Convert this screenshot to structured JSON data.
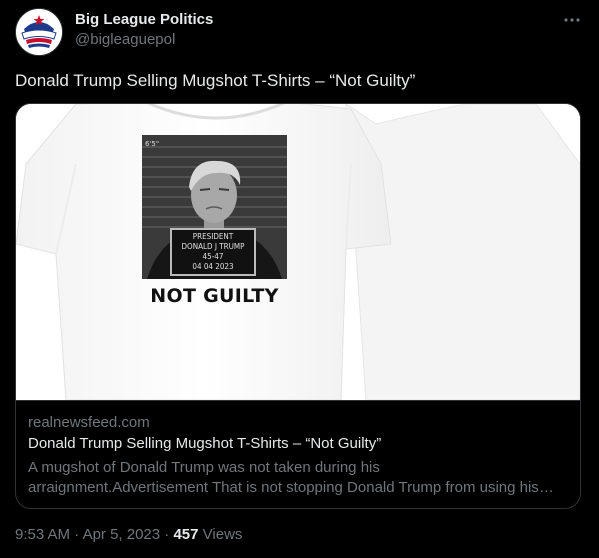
{
  "author": {
    "name": "Big League Politics",
    "handle": "@bigleaguepol",
    "avatar_text": "Big League Politics"
  },
  "tweet": {
    "text": "Donald Trump Selling Mugshot T-Shirts – “Not Guilty”"
  },
  "card": {
    "domain": "realnewsfeed.com",
    "title": "Donald Trump Selling Mugshot T-Shirts – “Not Guilty”",
    "description": "A mugshot of Donald Trump was not taken during his arraignment.Advertisement That is not stopping Donald Trump from using his arrest to sell merchandise.",
    "image": {
      "height_mark": "6'5\"",
      "placard_lines": [
        "PRESIDENT",
        "DONALD J TRUMP",
        "45-47",
        "04 04 2023"
      ],
      "shirt_text": "NOT GUILTY"
    }
  },
  "meta": {
    "time": "9:53 AM",
    "separator": " · ",
    "date": "Apr 5, 2023",
    "separator2": " · ",
    "views_count": "457",
    "views_label": " Views"
  },
  "icons": {
    "more": "more-horizontal-icon"
  },
  "colors": {
    "background": "#000000",
    "text_primary": "#e7e9ea",
    "text_secondary": "#71767b",
    "border": "#2f3336",
    "shirt": "#ffffff"
  }
}
